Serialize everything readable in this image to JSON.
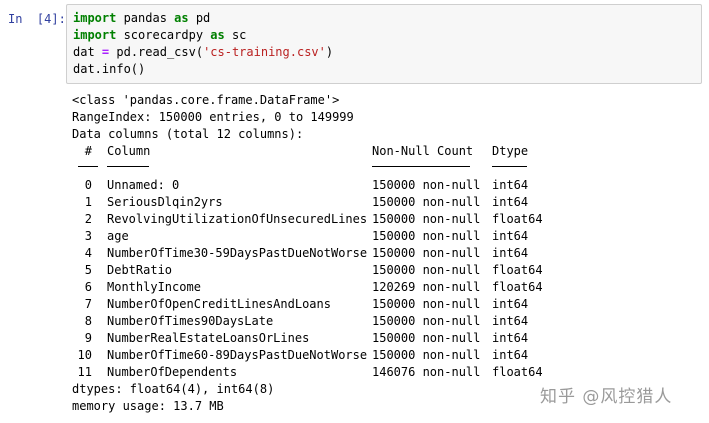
{
  "cell": {
    "prompt": "In  [4]:",
    "code": {
      "line1": {
        "kw1": "import",
        "mod": " pandas ",
        "kw2": "as",
        "alias": " pd"
      },
      "line2": {
        "kw1": "import",
        "mod": " scorecardpy ",
        "kw2": "as",
        "alias": " sc"
      },
      "line3": {
        "lhs": "dat ",
        "eq": "=",
        "call": " pd.read_csv(",
        "str": "'cs-training.csv'",
        "close": ")"
      },
      "line4": "dat.info()"
    }
  },
  "output": {
    "class_line": "<class 'pandas.core.frame.DataFrame'>",
    "range_index": "RangeIndex: 150000 entries, 0 to 149999",
    "data_columns": "Data columns (total 12 columns):",
    "headers": {
      "idx": "#",
      "column": "Column",
      "non_null": "Non-Null Count",
      "dtype": "Dtype"
    },
    "rows": [
      {
        "idx": "0",
        "name": "Unnamed: 0",
        "non_null": "150000 non-null",
        "dtype": "int64"
      },
      {
        "idx": "1",
        "name": "SeriousDlqin2yrs",
        "non_null": "150000 non-null",
        "dtype": "int64"
      },
      {
        "idx": "2",
        "name": "RevolvingUtilizationOfUnsecuredLines",
        "non_null": "150000 non-null",
        "dtype": "float64"
      },
      {
        "idx": "3",
        "name": "age",
        "non_null": "150000 non-null",
        "dtype": "int64"
      },
      {
        "idx": "4",
        "name": "NumberOfTime30-59DaysPastDueNotWorse",
        "non_null": "150000 non-null",
        "dtype": "int64"
      },
      {
        "idx": "5",
        "name": "DebtRatio",
        "non_null": "150000 non-null",
        "dtype": "float64"
      },
      {
        "idx": "6",
        "name": "MonthlyIncome",
        "non_null": "120269 non-null",
        "dtype": "float64"
      },
      {
        "idx": "7",
        "name": "NumberOfOpenCreditLinesAndLoans",
        "non_null": "150000 non-null",
        "dtype": "int64"
      },
      {
        "idx": "8",
        "name": "NumberOfTimes90DaysLate",
        "non_null": "150000 non-null",
        "dtype": "int64"
      },
      {
        "idx": "9",
        "name": "NumberRealEstateLoansOrLines",
        "non_null": "150000 non-null",
        "dtype": "int64"
      },
      {
        "idx": "10",
        "name": "NumberOfTime60-89DaysPastDueNotWorse",
        "non_null": "150000 non-null",
        "dtype": "int64"
      },
      {
        "idx": "11",
        "name": "NumberOfDependents",
        "non_null": "146076 non-null",
        "dtype": "float64"
      }
    ],
    "dtypes_line": "dtypes: float64(4), int64(8)",
    "memory_line": "memory usage: 13.7 MB"
  },
  "watermark": "知乎 @风控猎人",
  "colors": {
    "keyword": "#008000",
    "operator": "#aa22ff",
    "string": "#ba2121",
    "prompt": "#303f9f",
    "input_bg": "#f7f7f7",
    "input_border": "#cfcfcf"
  }
}
